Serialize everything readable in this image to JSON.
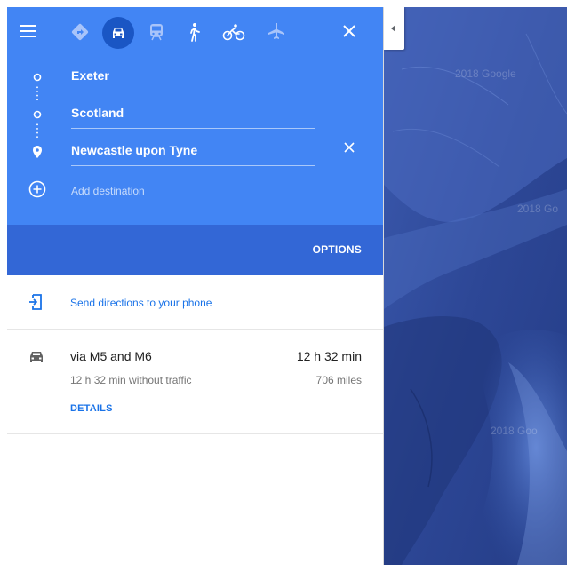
{
  "modes": {
    "menu": "menu-icon",
    "best": "directions-icon",
    "driving": "car-icon",
    "transit": "train-icon",
    "walking": "walking-icon",
    "cycling": "bicycle-icon",
    "flights": "plane-icon",
    "close": "close-icon"
  },
  "stops": [
    {
      "value": "Exeter"
    },
    {
      "value": "Scotland"
    },
    {
      "value": "Newcastle upon Tyne"
    }
  ],
  "add_destination_placeholder": "Add destination",
  "options_label": "OPTIONS",
  "send_label": "Send directions to your phone",
  "route": {
    "name": "via M5 and M6",
    "time": "12 h 32 min",
    "sub": "12 h 32 min without traffic",
    "distance": "706 miles",
    "details_label": "DETAILS"
  },
  "map": {
    "watermarks": [
      "2018 Google",
      "2018 Go",
      "2018 Goo"
    ]
  },
  "colors": {
    "header": "#4285f4",
    "header_dark": "#3367d6",
    "link": "#1a73e8",
    "map": "#2f4a9c"
  }
}
